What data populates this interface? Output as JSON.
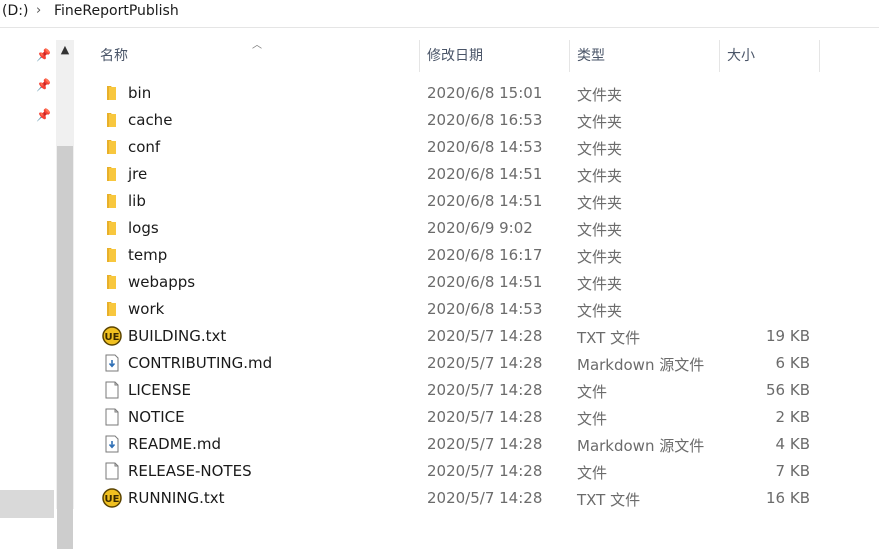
{
  "address": {
    "drive": "(D:)",
    "folder": "FineReportPublish"
  },
  "columns": {
    "name": "名称",
    "date": "修改日期",
    "type": "类型",
    "size": "大小"
  },
  "files": [
    {
      "icon": "folder-icon",
      "name": "bin",
      "date": "2020/6/8 15:01",
      "type": "文件夹",
      "size": ""
    },
    {
      "icon": "folder-icon",
      "name": "cache",
      "date": "2020/6/8 16:53",
      "type": "文件夹",
      "size": ""
    },
    {
      "icon": "folder-icon",
      "name": "conf",
      "date": "2020/6/8 14:53",
      "type": "文件夹",
      "size": ""
    },
    {
      "icon": "folder-icon",
      "name": "jre",
      "date": "2020/6/8 14:51",
      "type": "文件夹",
      "size": ""
    },
    {
      "icon": "folder-icon",
      "name": "lib",
      "date": "2020/6/8 14:51",
      "type": "文件夹",
      "size": ""
    },
    {
      "icon": "folder-icon",
      "name": "logs",
      "date": "2020/6/9 9:02",
      "type": "文件夹",
      "size": ""
    },
    {
      "icon": "folder-icon",
      "name": "temp",
      "date": "2020/6/8 16:17",
      "type": "文件夹",
      "size": ""
    },
    {
      "icon": "folder-icon",
      "name": "webapps",
      "date": "2020/6/8 14:51",
      "type": "文件夹",
      "size": ""
    },
    {
      "icon": "folder-icon",
      "name": "work",
      "date": "2020/6/8 14:53",
      "type": "文件夹",
      "size": ""
    },
    {
      "icon": "ue-text-icon",
      "name": "BUILDING.txt",
      "date": "2020/5/7 14:28",
      "type": "TXT 文件",
      "size": "19 KB"
    },
    {
      "icon": "markdown-icon",
      "name": "CONTRIBUTING.md",
      "date": "2020/5/7 14:28",
      "type": "Markdown 源文件",
      "size": "6 KB"
    },
    {
      "icon": "blank-file-icon",
      "name": "LICENSE",
      "date": "2020/5/7 14:28",
      "type": "文件",
      "size": "56 KB"
    },
    {
      "icon": "blank-file-icon",
      "name": "NOTICE",
      "date": "2020/5/7 14:28",
      "type": "文件",
      "size": "2 KB"
    },
    {
      "icon": "markdown-icon",
      "name": "README.md",
      "date": "2020/5/7 14:28",
      "type": "Markdown 源文件",
      "size": "4 KB"
    },
    {
      "icon": "blank-file-icon",
      "name": "RELEASE-NOTES",
      "date": "2020/5/7 14:28",
      "type": "文件",
      "size": "7 KB"
    },
    {
      "icon": "ue-text-icon",
      "name": "RUNNING.txt",
      "date": "2020/5/7 14:28",
      "type": "TXT 文件",
      "size": "16 KB"
    }
  ],
  "colors": {
    "folder": "#f8c73e",
    "selection": "#d9d9d9",
    "header_text": "#4a5568"
  }
}
